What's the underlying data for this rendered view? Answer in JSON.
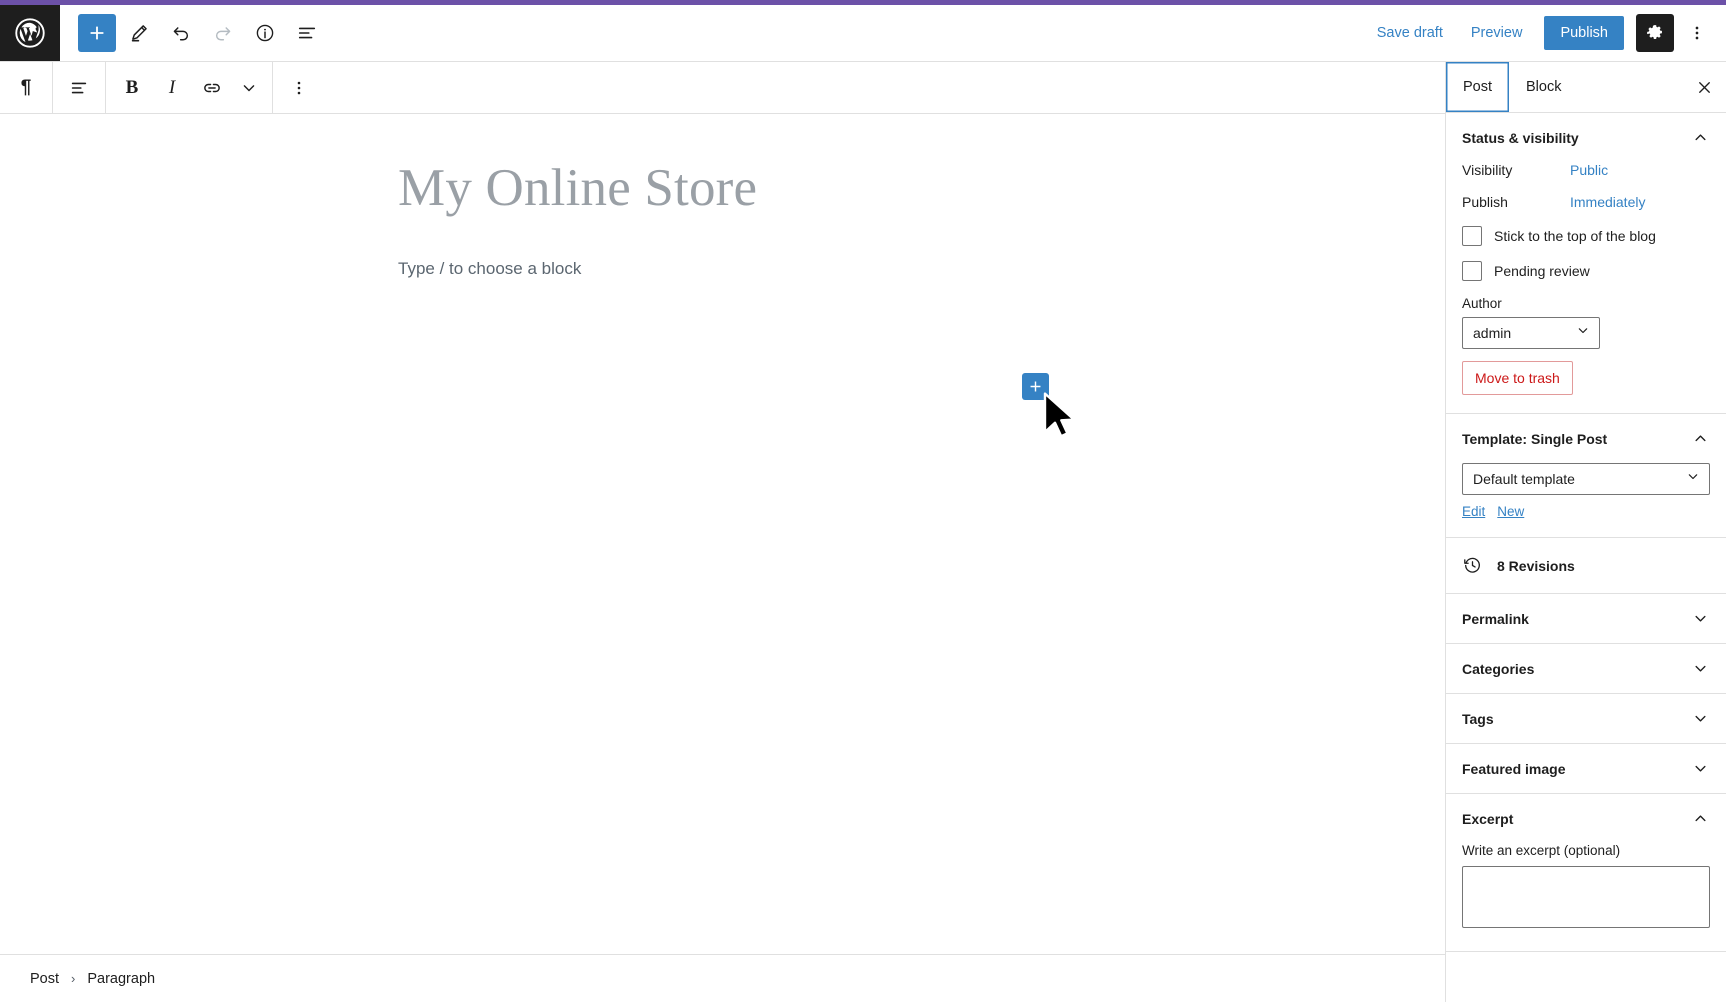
{
  "window": {
    "accent_purple": "#6c51a8",
    "brand_blue": "#3582c4",
    "danger_red": "#cc1818"
  },
  "header": {
    "logo_icon": "wordpress-logo-icon",
    "left_tools": [
      {
        "name": "toggle-block-inserter",
        "icon": "plus-icon",
        "label": "Toggle block inserter",
        "state": "primary"
      },
      {
        "name": "tools-mode",
        "icon": "pencil-icon",
        "label": "Tools",
        "state": "normal"
      },
      {
        "name": "undo",
        "icon": "undo-arrow-icon",
        "label": "Undo",
        "state": "normal"
      },
      {
        "name": "redo",
        "icon": "redo-arrow-icon",
        "label": "Redo",
        "state": "disabled"
      },
      {
        "name": "details",
        "icon": "info-circle-icon",
        "label": "Details",
        "state": "normal"
      },
      {
        "name": "list-view",
        "icon": "list-view-icon",
        "label": "List View",
        "state": "normal"
      }
    ],
    "save_draft_label": "Save draft",
    "preview_label": "Preview",
    "publish_label": "Publish",
    "settings_icon": "gear-icon",
    "settings_label": "Settings",
    "options_icon": "kebab-vertical-icon",
    "options_label": "Options"
  },
  "block_toolbar": {
    "buttons": [
      {
        "name": "block-type-paragraph",
        "icon": "pilcrow-icon",
        "glyph": "¶",
        "label": "Paragraph"
      },
      {
        "name": "align-text",
        "icon": "align-left-icon",
        "label": "Align text"
      },
      {
        "name": "bold",
        "icon": "bold-icon",
        "glyph": "B",
        "label": "Bold"
      },
      {
        "name": "italic",
        "icon": "italic-icon",
        "glyph": "I",
        "label": "Italic"
      },
      {
        "name": "link",
        "icon": "link-icon",
        "label": "Link"
      },
      {
        "name": "more-rich-text",
        "icon": "chevron-down-icon",
        "label": "More"
      },
      {
        "name": "block-options",
        "icon": "kebab-vertical-icon",
        "label": "Options"
      }
    ]
  },
  "editor": {
    "title": "My Online Store",
    "title_placeholder": "Add title",
    "paragraph_placeholder": "Type / to choose a block",
    "inserter_icon": "plus-icon",
    "inserter_label": "Add block",
    "cursor_icon": "mouse-pointer-icon"
  },
  "footer": {
    "breadcrumb": [
      {
        "name": "breadcrumb-post",
        "label": "Post"
      },
      {
        "name": "breadcrumb-paragraph",
        "label": "Paragraph"
      }
    ],
    "separator": "›"
  },
  "sidebar": {
    "tabs": [
      {
        "name": "tab-post",
        "label": "Post",
        "active": true
      },
      {
        "name": "tab-block",
        "label": "Block",
        "active": false
      }
    ],
    "close_icon": "close-icon",
    "close_label": "Close settings",
    "status_panel": {
      "title": "Status & visibility",
      "expanded": true,
      "visibility_label": "Visibility",
      "visibility_value": "Public",
      "publish_label": "Publish",
      "publish_value": "Immediately",
      "sticky_label": "Stick to the top of the blog",
      "sticky_checked": false,
      "pending_label": "Pending review",
      "pending_checked": false,
      "author_label": "Author",
      "author_value": "admin",
      "trash_label": "Move to trash"
    },
    "template_panel": {
      "title": "Template: Single Post",
      "expanded": true,
      "template_value": "Default template",
      "edit_label": "Edit",
      "new_label": "New"
    },
    "revisions": {
      "icon": "revisions-clock-icon",
      "label": "8 Revisions",
      "count": 8
    },
    "collapsed_panels": [
      {
        "name": "panel-permalink",
        "title": "Permalink"
      },
      {
        "name": "panel-categories",
        "title": "Categories"
      },
      {
        "name": "panel-tags",
        "title": "Tags"
      },
      {
        "name": "panel-featured-image",
        "title": "Featured image"
      }
    ],
    "excerpt_panel": {
      "title": "Excerpt",
      "expanded": true,
      "field_label": "Write an excerpt (optional)",
      "value": "",
      "placeholder": ""
    }
  }
}
